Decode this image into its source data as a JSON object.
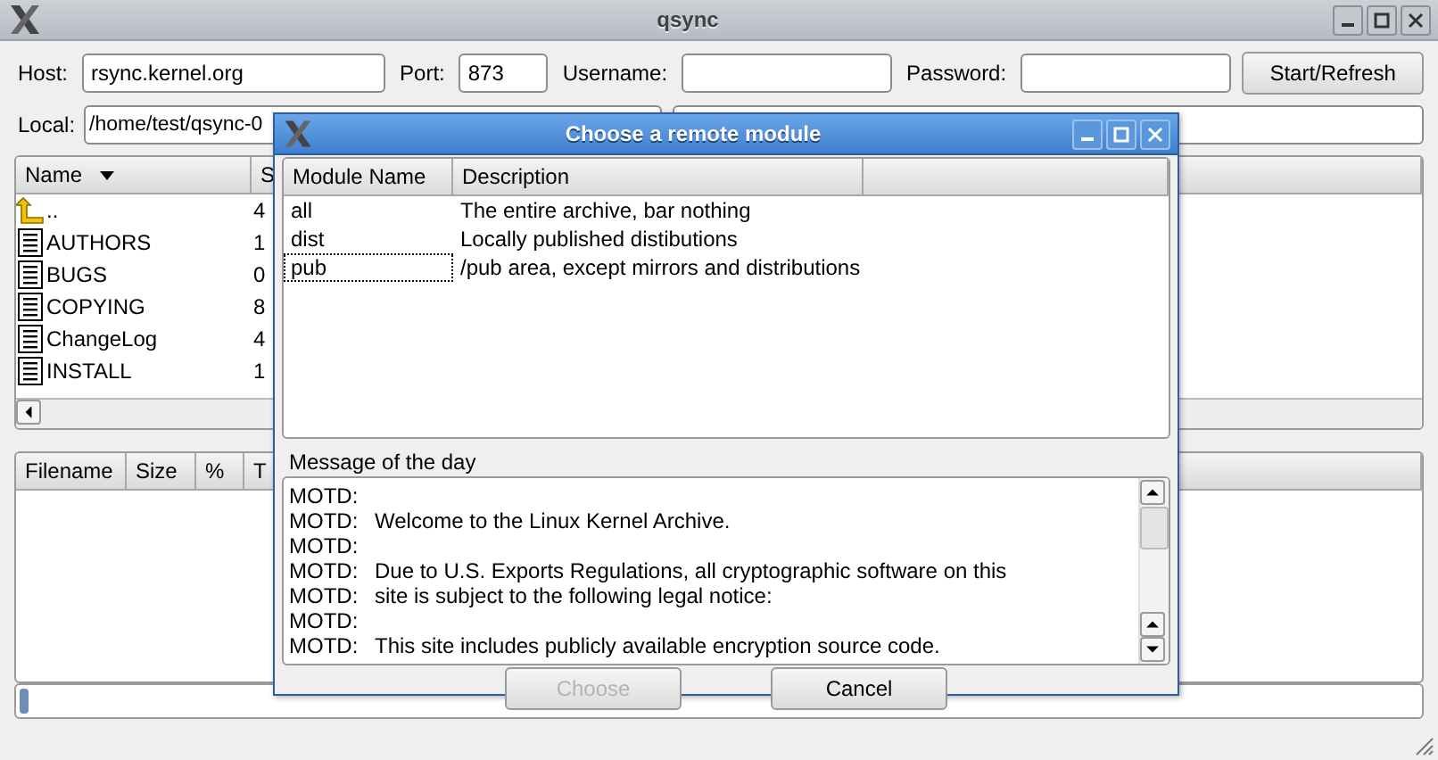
{
  "window": {
    "title": "qsync"
  },
  "connection": {
    "host_label": "Host:",
    "host": "rsync.kernel.org",
    "port_label": "Port:",
    "port": "873",
    "username_label": "Username:",
    "password_label": "Password:",
    "start_button": "Start/Refresh"
  },
  "local": {
    "label": "Local:",
    "path": "/home/test/qsync-0"
  },
  "file_list": {
    "columns": [
      "Name",
      "S"
    ],
    "rows": [
      {
        "kind": "parent",
        "name": "..",
        "size": "4"
      },
      {
        "kind": "file",
        "name": "AUTHORS",
        "size": "1"
      },
      {
        "kind": "file",
        "name": "BUGS",
        "size": "0"
      },
      {
        "kind": "file",
        "name": "COPYING",
        "size": "8"
      },
      {
        "kind": "file",
        "name": "ChangeLog",
        "size": "4"
      },
      {
        "kind": "file",
        "name": "INSTALL",
        "size": "1"
      }
    ]
  },
  "transfers": {
    "columns": [
      "Filename",
      "Size",
      "%",
      "T"
    ]
  },
  "progress": {
    "level": 0.006
  },
  "dialog": {
    "title": "Choose a remote module",
    "columns": [
      "Module Name",
      "Description"
    ],
    "modules": [
      {
        "name": "all",
        "description": "The entire archive, bar nothing",
        "focused": false
      },
      {
        "name": "dist",
        "description": "Locally published distibutions",
        "focused": false
      },
      {
        "name": "pub",
        "description": "/pub area, except mirrors and distributions",
        "focused": true
      }
    ],
    "motd_label": "Message of the day",
    "motd": [
      {
        "prefix": "MOTD:"
      },
      {
        "prefix": "MOTD:",
        "text": "Welcome to the Linux Kernel Archive."
      },
      {
        "prefix": "MOTD:"
      },
      {
        "prefix": "MOTD:",
        "text": "Due to U.S. Exports Regulations, all cryptographic software on this"
      },
      {
        "prefix": "MOTD:",
        "text": "site is subject to the following legal notice:"
      },
      {
        "prefix": "MOTD:"
      },
      {
        "prefix": "MOTD:",
        "text": "This site includes publicly available encryption source code."
      }
    ],
    "buttons": [
      {
        "label": "Choose",
        "disabled": true
      },
      {
        "label": "Cancel",
        "disabled": false
      }
    ]
  }
}
